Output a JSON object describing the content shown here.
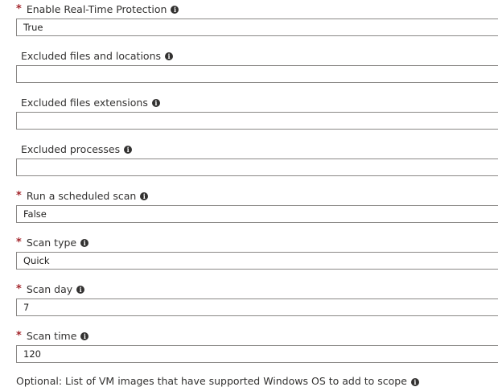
{
  "fields": [
    {
      "label": "Enable Real-Time Protection",
      "required": "*",
      "value": "True"
    },
    {
      "label": "Excluded files and locations",
      "required": "",
      "value": ""
    },
    {
      "label": "Excluded files extensions",
      "required": "",
      "value": ""
    },
    {
      "label": "Excluded processes",
      "required": "",
      "value": ""
    },
    {
      "label": "Run a scheduled scan",
      "required": "*",
      "value": "False"
    },
    {
      "label": "Scan type",
      "required": "*",
      "value": "Quick"
    },
    {
      "label": "Scan day",
      "required": "*",
      "value": "7"
    },
    {
      "label": "Scan time",
      "required": "*",
      "value": "120"
    }
  ],
  "optional_label": "Optional: List of VM images that have supported Windows OS to add to scope",
  "info_glyph": "i",
  "colors": {
    "required_marker": "#a4262c",
    "border": "#8a8886",
    "text": "#323130"
  }
}
